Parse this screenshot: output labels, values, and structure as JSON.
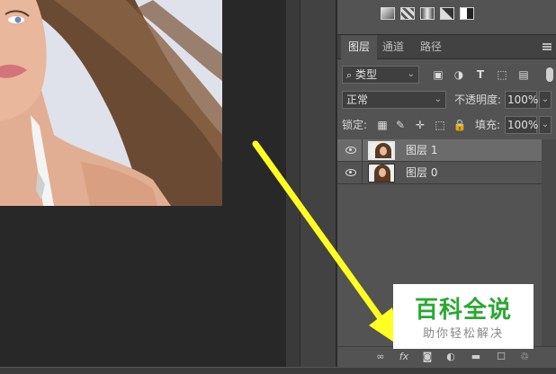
{
  "panel": {
    "tabs": [
      {
        "label": "图层",
        "active": true
      },
      {
        "label": "通道",
        "active": false
      },
      {
        "label": "路径",
        "active": false
      }
    ],
    "filter": {
      "kind_label": "类型",
      "icons": [
        "image-filter-icon",
        "adjustment-filter-icon",
        "type-filter-icon",
        "shape-filter-icon",
        "smart-object-filter-icon"
      ]
    },
    "blend_mode": "正常",
    "opacity_label": "不透明度:",
    "opacity_value": "100%",
    "lock_label": "锁定:",
    "fill_label": "填充:",
    "fill_value": "100%",
    "layers": [
      {
        "name": "图层 1",
        "visible": true,
        "selected": true
      },
      {
        "name": "图层 0",
        "visible": true,
        "selected": false
      }
    ],
    "bottom_icons": [
      "link-layers-icon",
      "fx-icon",
      "add-mask-icon",
      "adjustment-layer-icon",
      "new-group-icon",
      "new-layer-icon",
      "delete-layer-icon"
    ],
    "fx_label": "fx"
  },
  "watermark": {
    "title": "百科全说",
    "subtitle": "助你轻松解决"
  },
  "colors": {
    "panel_bg": "#535353",
    "selected_row": "#6b6b6b",
    "arrow": "#ffff22",
    "watermark_green": "#2aa832"
  }
}
